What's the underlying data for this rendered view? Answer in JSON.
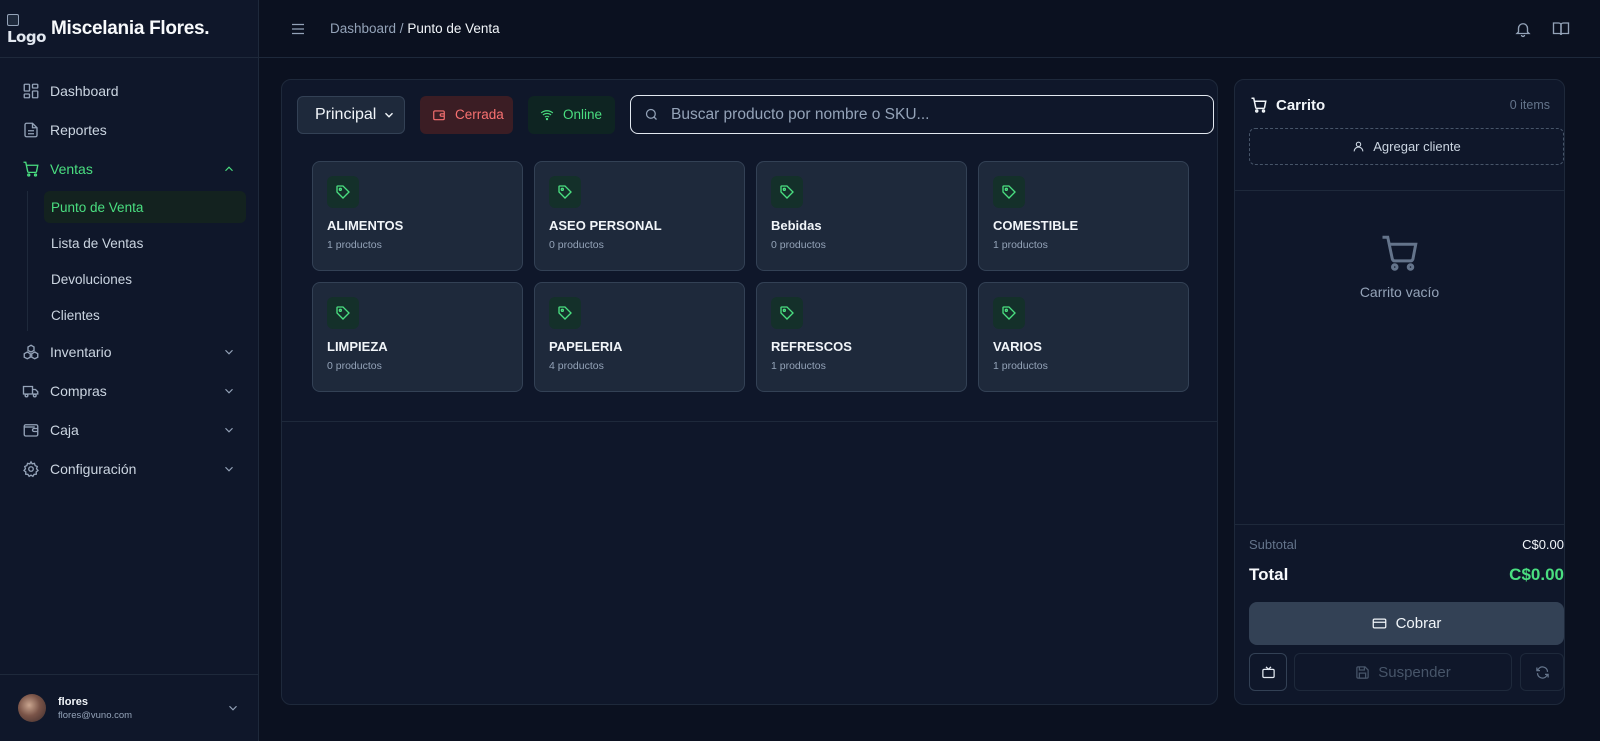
{
  "brand": {
    "logo_alt": "Logo",
    "name": "Miscelania Flores."
  },
  "nav": {
    "dashboard": "Dashboard",
    "reportes": "Reportes",
    "ventas": "Ventas",
    "ventas_sub": [
      "Punto de Venta",
      "Lista de Ventas",
      "Devoluciones",
      "Clientes"
    ],
    "inventario": "Inventario",
    "compras": "Compras",
    "caja": "Caja",
    "configuracion": "Configuración"
  },
  "user": {
    "name": "flores",
    "email": "flores@vuno.com"
  },
  "header": {
    "crumb_parent": "Dashboard",
    "crumb_sep": " / ",
    "crumb_current": "Punto de Venta"
  },
  "toolbar": {
    "warehouse": "Principal",
    "register_status": "Cerrada",
    "connection_status": "Online",
    "search_placeholder": "Buscar producto por nombre o SKU..."
  },
  "categories": [
    {
      "name": "ALIMENTOS",
      "count": "1 productos"
    },
    {
      "name": "ASEO PERSONAL",
      "count": "0 productos"
    },
    {
      "name": "Bebidas",
      "count": "0 productos"
    },
    {
      "name": "COMESTIBLE",
      "count": "1 productos"
    },
    {
      "name": "LIMPIEZA",
      "count": "0 productos"
    },
    {
      "name": "PAPELERIA",
      "count": "4 productos"
    },
    {
      "name": "REFRESCOS",
      "count": "1 productos"
    },
    {
      "name": "VARIOS",
      "count": "1 productos"
    }
  ],
  "cart": {
    "title": "Carrito",
    "count": "0 items",
    "add_client": "Agregar cliente",
    "empty": "Carrito vacío",
    "subtotal_label": "Subtotal",
    "subtotal_value": "C$0.00",
    "total_label": "Total",
    "total_value": "C$0.00",
    "pay_label": "Cobrar",
    "suspend_label": "Suspender"
  },
  "colors": {
    "accent": "#4ade80",
    "danger": "#f87171",
    "background": "#0b1120",
    "panel": "#0f172a",
    "card": "#1e293b"
  },
  "icons": [
    "dashboard-icon",
    "report-icon",
    "cart-icon",
    "chevron-down-icon",
    "chevron-up-icon",
    "boxes-icon",
    "truck-icon",
    "wallet-icon",
    "gear-icon",
    "menu-icon",
    "bell-icon",
    "book-icon",
    "wifi-icon",
    "search-icon",
    "tag-icon",
    "user-icon",
    "credit-card-icon",
    "tv-icon",
    "save-icon",
    "refresh-icon"
  ]
}
